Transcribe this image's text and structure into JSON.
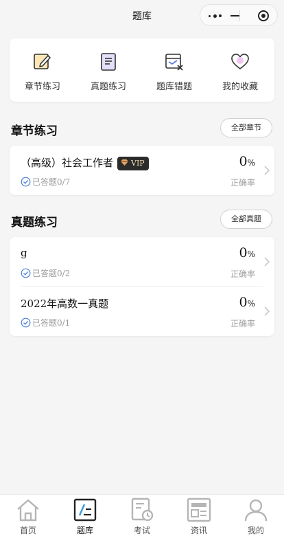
{
  "nav": {
    "title": "题库"
  },
  "quick": [
    {
      "label": "章节练习",
      "icon": "edit-note-icon"
    },
    {
      "label": "真题练习",
      "icon": "document-list-icon"
    },
    {
      "label": "题库错题",
      "icon": "wrong-questions-icon"
    },
    {
      "label": "我的收藏",
      "icon": "heart-icon"
    }
  ],
  "chapter": {
    "title": "章节练习",
    "all_label": "全部章节",
    "items": [
      {
        "name": "（高级）社会工作者",
        "badge": "VIP",
        "answered": "已答题0/7",
        "percent": "0",
        "unit": "%",
        "accuracy_label": "正确率"
      }
    ]
  },
  "exam": {
    "title": "真题练习",
    "all_label": "全部真题",
    "items": [
      {
        "name": "g",
        "answered": "已答题0/2",
        "percent": "0",
        "unit": "%",
        "accuracy_label": "正确率"
      },
      {
        "name": "2022年高数一真题",
        "answered": "已答题0/1",
        "percent": "0",
        "unit": "%",
        "accuracy_label": "正确率"
      }
    ]
  },
  "tabs": [
    {
      "label": "首页",
      "icon": "home-icon"
    },
    {
      "label": "题库",
      "icon": "question-bank-icon",
      "active": true
    },
    {
      "label": "考试",
      "icon": "exam-icon"
    },
    {
      "label": "资讯",
      "icon": "news-icon"
    },
    {
      "label": "我的",
      "icon": "user-icon"
    }
  ],
  "colors": {
    "accent": "#3a7bd5",
    "tab_inactive": "#b5b5b5",
    "vip_bg": "#2b2b2b",
    "vip_text": "#f3d9b1"
  }
}
